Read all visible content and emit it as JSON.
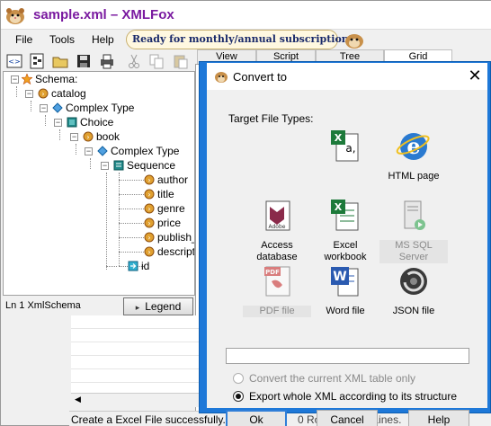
{
  "window": {
    "title": "sample.xml – XMLFox",
    "promo_text": "Ready for monthly/annual subscription?"
  },
  "menu": {
    "items": [
      {
        "label": "File"
      },
      {
        "label": "Tools"
      },
      {
        "label": "Help"
      }
    ]
  },
  "toolbar": {
    "buttons": [
      "xml-source-icon",
      "schema-icon",
      "open-folder-icon",
      "save-icon",
      "print-icon",
      "cut-icon",
      "copy-icon",
      "paste-icon"
    ]
  },
  "tabs": [
    {
      "label": "View"
    },
    {
      "label": "Script"
    },
    {
      "label": "Tree"
    },
    {
      "label": "Grid"
    }
  ],
  "tree": {
    "nodes": [
      {
        "label": "Schema:",
        "icon": "star-icon"
      },
      {
        "label": "catalog",
        "icon": "element-icon"
      },
      {
        "label": "Complex Type",
        "icon": "complex-type-icon"
      },
      {
        "label": "Choice",
        "icon": "choice-icon"
      },
      {
        "label": "book",
        "icon": "element-icon"
      },
      {
        "label": "Complex Type",
        "icon": "complex-type-icon"
      },
      {
        "label": "Sequence",
        "icon": "sequence-icon"
      },
      {
        "label": "author",
        "icon": "element-icon"
      },
      {
        "label": "title",
        "icon": "element-icon"
      },
      {
        "label": "genre",
        "icon": "element-icon"
      },
      {
        "label": "price",
        "icon": "element-icon"
      },
      {
        "label": "publish_",
        "icon": "element-icon"
      },
      {
        "label": "descript",
        "icon": "element-icon"
      },
      {
        "label": "id",
        "icon": "attribute-icon"
      }
    ]
  },
  "status": {
    "left": "Ln 1  XmlSchema",
    "legend_label": "Legend",
    "bottom_message": "Create a Excel File successfully.",
    "bottom_right": "0 Rows, 1 – 12 Lines."
  },
  "dialog": {
    "title": "Convert to",
    "target_label": "Target File Types:",
    "options": [
      {
        "id": "excel-cells",
        "label": "",
        "enabled": true
      },
      {
        "id": "html-page",
        "label": "HTML page",
        "enabled": true
      },
      {
        "id": "access-db",
        "label": "Access database",
        "label_line1": "Access",
        "label_line2": "database",
        "enabled": true
      },
      {
        "id": "excel-workbook",
        "label_line1": "Excel",
        "label_line2": "workbook",
        "enabled": true
      },
      {
        "id": "ms-sql",
        "label_line1": "MS SQL",
        "label_line2": "Server",
        "enabled": false
      },
      {
        "id": "pdf-file",
        "label": "PDF file",
        "enabled": false
      },
      {
        "id": "word-file",
        "label": "Word file",
        "enabled": true
      },
      {
        "id": "json-file",
        "label": "JSON file",
        "enabled": true
      }
    ],
    "path_value": "",
    "radio_options": [
      {
        "label": "Convert the current XML table only",
        "checked": false,
        "enabled": false
      },
      {
        "label": "Export whole XML according to its structure",
        "checked": true,
        "enabled": true
      }
    ],
    "buttons": {
      "ok": "Ok",
      "cancel": "Cancel",
      "help": "Help"
    }
  },
  "colors": {
    "title_text": "#7a1aa0",
    "dialog_frame": "#1e78d8",
    "promo_text": "#1a2a6a"
  }
}
